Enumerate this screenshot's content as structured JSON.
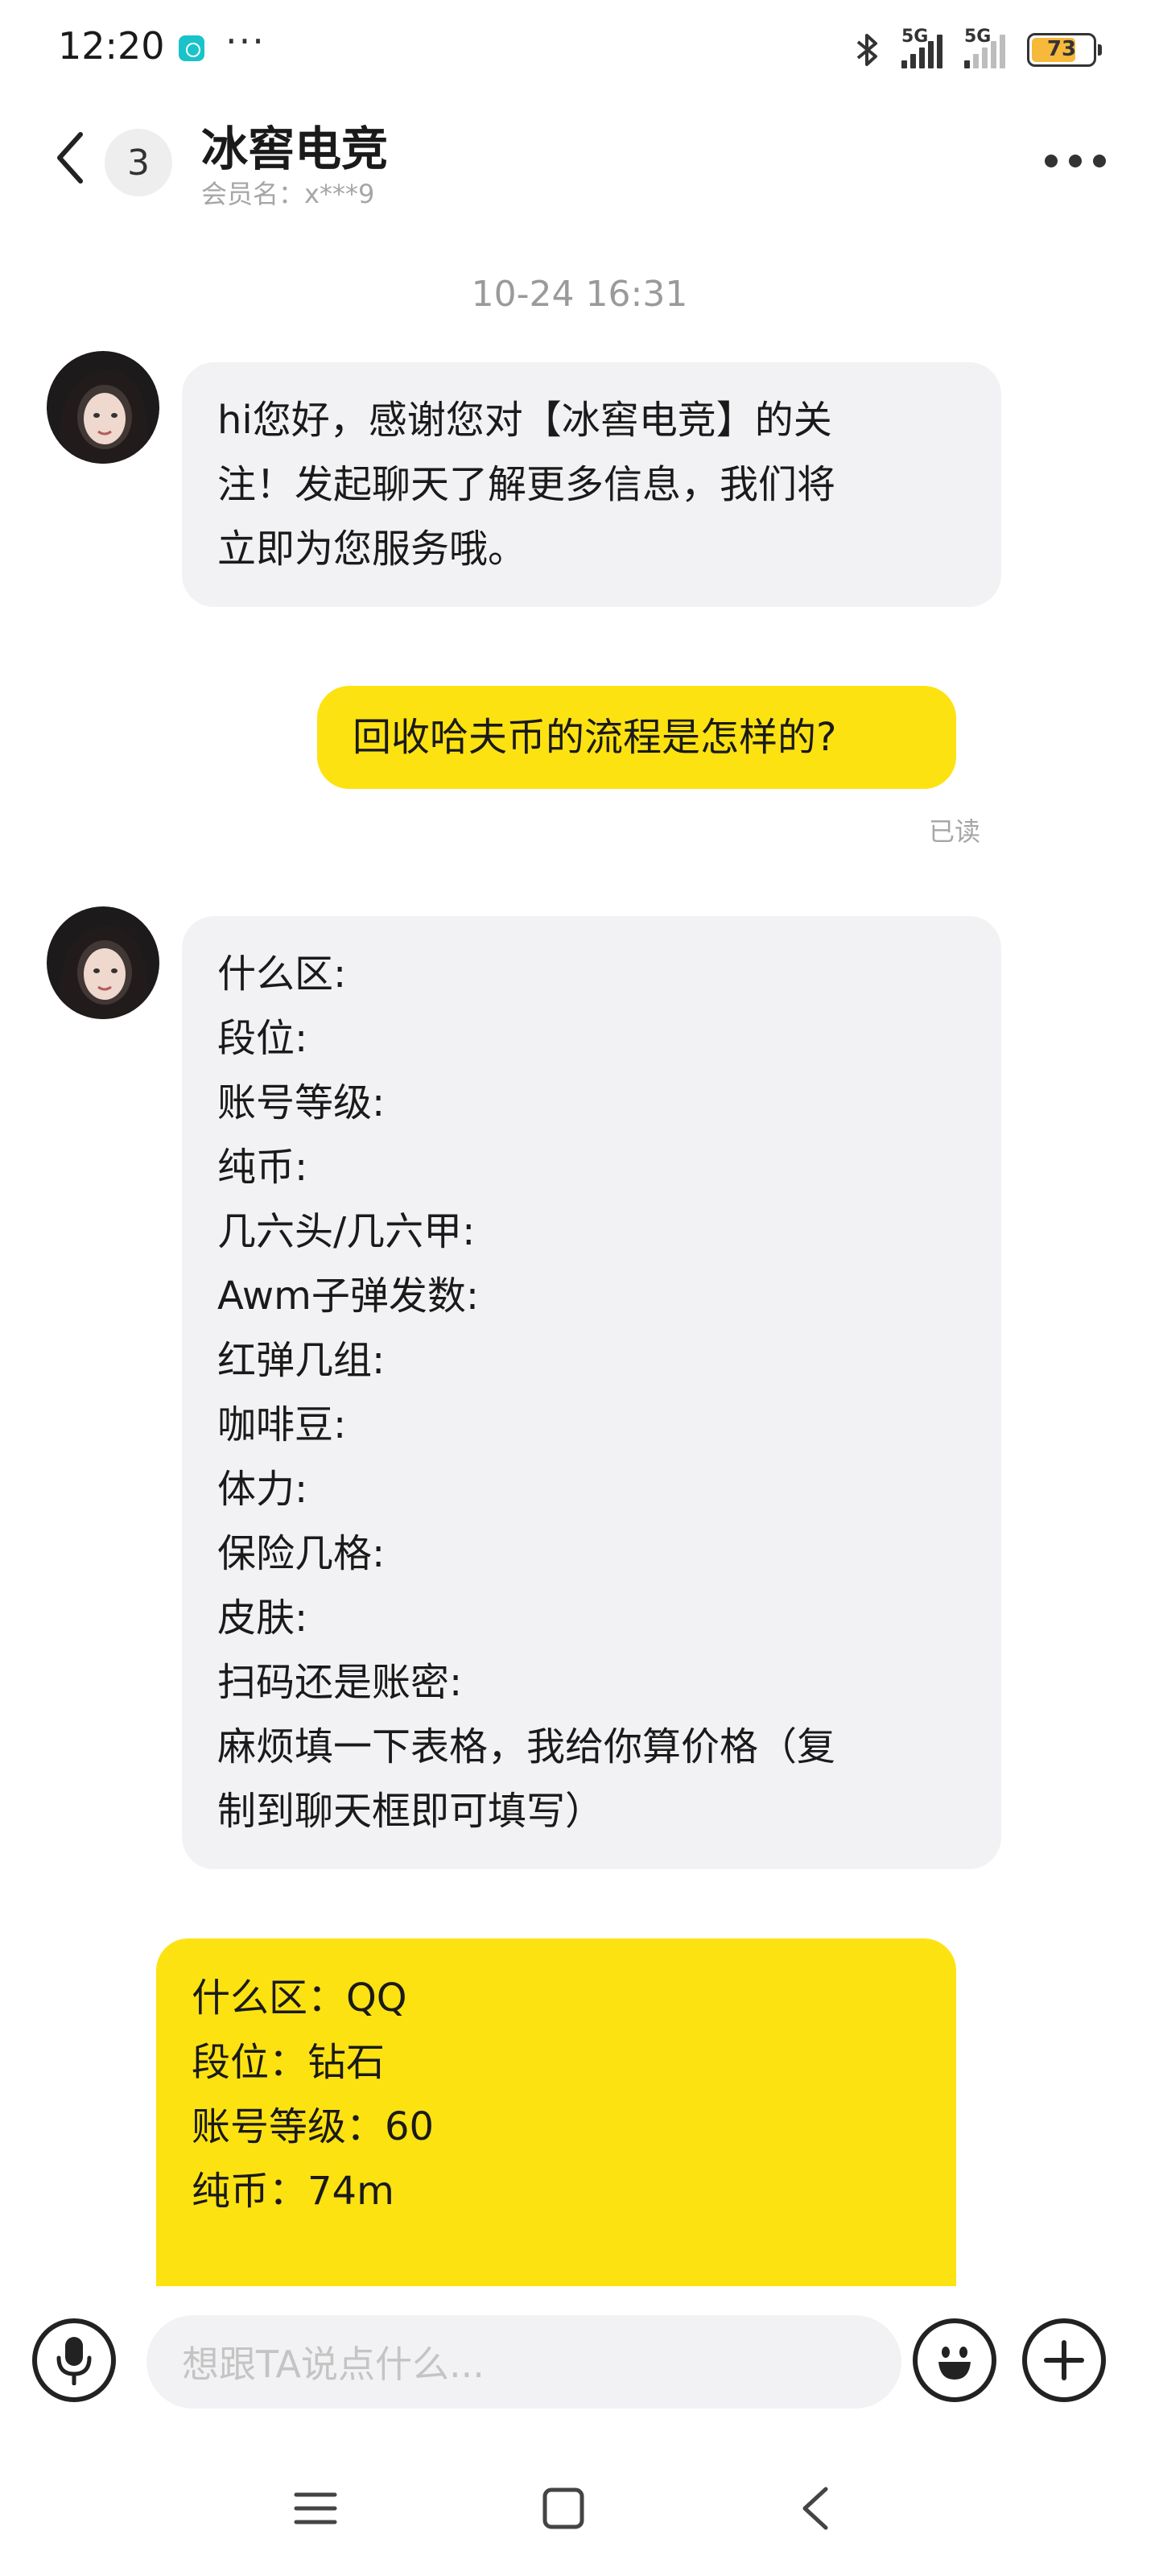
{
  "status_bar": {
    "time": "12:20",
    "more": "···",
    "signal1_label": "5G",
    "signal2_label": "5G",
    "battery_percent": "73",
    "battery_level": 0.73
  },
  "header": {
    "back_icon": "chevron-left-icon",
    "unread_count": "3",
    "title": "冰窖电竞",
    "subtitle": "会员名：x***9",
    "more_icon": "more-horizontal-icon"
  },
  "chat": {
    "timestamp": "10-24 16:31",
    "messages": [
      {
        "direction": "in",
        "lines": [
          "hi您好，感谢您对【冰窖电竞】的关",
          "注！发起聊天了解更多信息，我们将",
          "立即为您服务哦。"
        ]
      },
      {
        "direction": "out",
        "lines": [
          "回收哈夫币的流程是怎样的?"
        ],
        "status": "已读"
      },
      {
        "direction": "in",
        "lines": [
          "什么区:",
          "段位:",
          "账号等级:",
          "纯币:",
          "几六头/几六甲:",
          "Awm子弹发数:",
          "红弹几组:",
          "咖啡豆:",
          "体力:",
          "保险几格:",
          "皮肤:",
          "扫码还是账密:",
          "麻烦填一下表格，我给你算价格（复",
          "制到聊天框即可填写）"
        ]
      },
      {
        "direction": "out",
        "lines": [
          "什么区：QQ",
          "段位：钻石",
          "账号等级：60",
          "纯币：74m"
        ]
      }
    ]
  },
  "input_bar": {
    "voice_icon": "microphone-icon",
    "placeholder": "想跟TA说点什么...",
    "emoji_icon": "emoji-icon",
    "add_icon": "plus-icon"
  },
  "nav_bar": {
    "menu_icon": "menu-icon",
    "home_icon": "home-square-icon",
    "back_icon": "back-triangle-icon"
  },
  "colors": {
    "outgoing_bubble": "#fde211",
    "incoming_bubble": "#f2f2f4",
    "muted_text": "#a6a6a6"
  }
}
